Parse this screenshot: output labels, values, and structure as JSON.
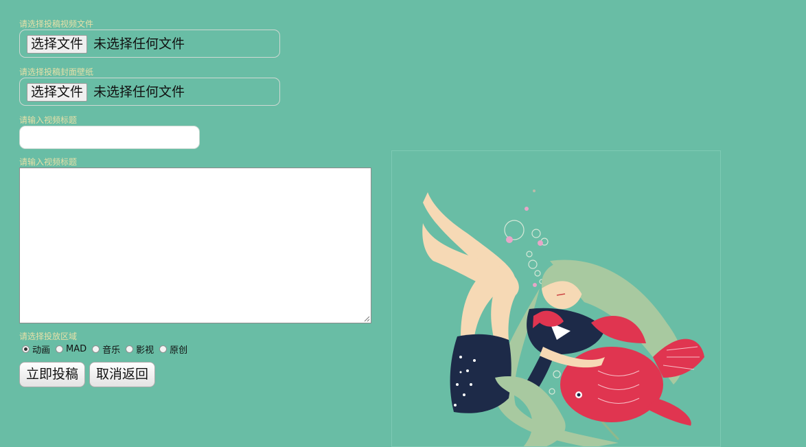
{
  "form": {
    "video_file_label": "请选择投稿视频文件",
    "cover_file_label": "请选择投稿封面壁纸",
    "choose_file_button": "选择文件",
    "no_file_text": "未选择任何文件",
    "title_label": "请输入视频标题",
    "title_value": "",
    "description_label": "请输入视频标题",
    "description_value": "",
    "region_label": "请选择投放区域",
    "regions": [
      "动画",
      "MAD",
      "音乐",
      "影视",
      "原创"
    ],
    "selected_region": "动画",
    "submit_button": "立即投稿",
    "cancel_button": "取消返回"
  },
  "colors": {
    "background": "#69bda5",
    "label": "#e6e0a8",
    "fish": "#e03550",
    "hair": "#a8c9a0",
    "uniform": "#1d2a48"
  },
  "illustration": {
    "icon": "girl-with-goldfish-illustration"
  }
}
